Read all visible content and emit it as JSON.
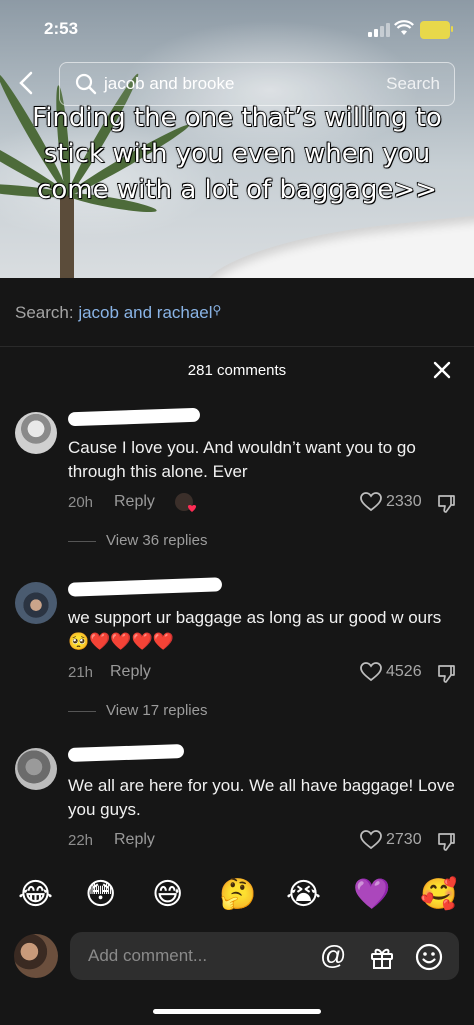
{
  "status_bar": {
    "time": "2:53"
  },
  "search": {
    "query": "jacob and brooke",
    "button": "Search"
  },
  "video": {
    "caption": "Finding the one that’s willing to stick with you even when you come with a lot of baggage>>"
  },
  "related_search": {
    "label": "Search:",
    "query": "jacob and rachael"
  },
  "comments_header": {
    "count": "281 comments"
  },
  "comments": [
    {
      "text": "Cause I love you. And wouldn’t want you to go through this alone. Ever",
      "age": "20h",
      "reply": "Reply",
      "likes": "2330",
      "view_replies": "View 36 replies"
    },
    {
      "text": "we support ur baggage as long as ur good w ours 🥺❤️❤️❤️❤️",
      "age": "21h",
      "reply": "Reply",
      "likes": "4526",
      "view_replies": "View 17 replies"
    },
    {
      "text": "We all are here for you. We all have baggage! Love you guys.",
      "age": "22h",
      "reply": "Reply",
      "likes": "2730"
    }
  ],
  "quick_emojis": [
    "😂",
    "😳",
    "😅",
    "🤔",
    "😭",
    "💜",
    "🥰"
  ],
  "composer": {
    "placeholder": "Add comment..."
  },
  "colors": {
    "link": "#8ab4e6",
    "background": "#161616",
    "battery": "#e8d84a"
  }
}
